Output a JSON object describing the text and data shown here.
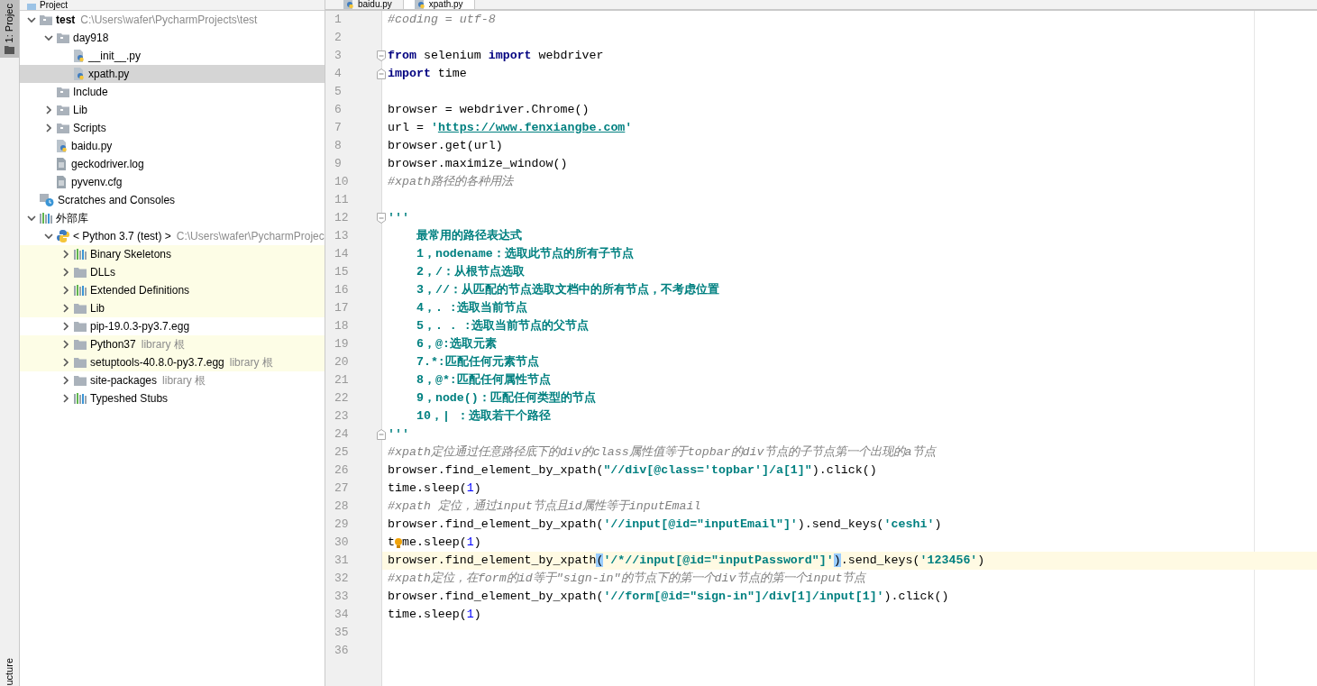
{
  "side_tabs": [
    {
      "label": "1: Projec",
      "selected": true
    },
    {
      "label": "ucture",
      "selected": false
    }
  ],
  "project_panel": {
    "title": "Project",
    "tree": [
      {
        "kind": "module",
        "name": "test",
        "bold": true,
        "hint": "C:\\Users\\wafer\\PycharmProjects\\test",
        "expanded": true,
        "children": [
          {
            "kind": "module",
            "name": "day918",
            "expanded": true,
            "children": [
              {
                "kind": "python",
                "name": "__init__.py"
              },
              {
                "kind": "python",
                "name": "xpath.py",
                "selected": true
              }
            ]
          },
          {
            "kind": "module",
            "name": "Include"
          },
          {
            "kind": "module",
            "name": "Lib",
            "expanded": false
          },
          {
            "kind": "module",
            "name": "Scripts",
            "expanded": false
          },
          {
            "kind": "python",
            "name": "baidu.py"
          },
          {
            "kind": "text",
            "name": "geckodriver.log"
          },
          {
            "kind": "text",
            "name": "pyvenv.cfg"
          }
        ]
      },
      {
        "kind": "scratch",
        "name": "Scratches and Consoles"
      },
      {
        "kind": "library",
        "name": "外部库",
        "expanded": true,
        "children": [
          {
            "kind": "sdk",
            "name": "< Python 3.7 (test) >",
            "hint": "C:\\Users\\wafer\\PycharmProjec",
            "expanded": true,
            "children": [
              {
                "kind": "library",
                "name": "Binary Skeletons",
                "expanded": false,
                "highlighted": true
              },
              {
                "kind": "folder",
                "name": "DLLs",
                "expanded": false,
                "highlighted": true
              },
              {
                "kind": "library",
                "name": "Extended Definitions",
                "expanded": false,
                "highlighted": true
              },
              {
                "kind": "folder",
                "name": "Lib",
                "expanded": false,
                "highlighted": true
              },
              {
                "kind": "folder",
                "name": "pip-19.0.3-py3.7.egg",
                "expanded": false,
                "highlighted": false
              },
              {
                "kind": "folder",
                "name": "Python37",
                "hint": "library 根",
                "expanded": false,
                "highlighted": true
              },
              {
                "kind": "folder",
                "name": "setuptools-40.8.0-py3.7.egg",
                "hint": "library 根",
                "expanded": false,
                "highlighted": true
              },
              {
                "kind": "folder",
                "name": "site-packages",
                "hint": "library 根",
                "expanded": false,
                "highlighted": false
              },
              {
                "kind": "library",
                "name": "Typeshed Stubs",
                "expanded": false,
                "highlighted": false
              }
            ]
          }
        ]
      }
    ]
  },
  "editor": {
    "tabs": [
      {
        "label": "baidu.py",
        "selected": false
      },
      {
        "label": "xpath.py",
        "selected": true
      }
    ],
    "lines": [
      {
        "number": "1",
        "tokens": [
          {
            "kind": "comment",
            "text": "#coding = utf-8"
          }
        ]
      },
      {
        "number": "2"
      },
      {
        "number": "3",
        "fold_start": true,
        "tokens": [
          {
            "kind": "keyword",
            "text": "from"
          },
          {
            "kind": "plain",
            "text": " selenium "
          },
          {
            "kind": "keyword",
            "text": "import"
          },
          {
            "kind": "plain",
            "text": " webdriver"
          }
        ]
      },
      {
        "number": "4",
        "fold_end": true,
        "tokens": [
          {
            "kind": "keyword",
            "text": "import"
          },
          {
            "kind": "plain",
            "text": " time"
          }
        ]
      },
      {
        "number": "5"
      },
      {
        "number": "6",
        "tokens": [
          {
            "kind": "plain",
            "text": "browser = webdriver.Chrome()"
          }
        ]
      },
      {
        "number": "7",
        "tokens": [
          {
            "kind": "plain",
            "text": "url = "
          },
          {
            "kind": "string",
            "text": "'"
          },
          {
            "kind": "url",
            "text": "https://www.fenxiangbe.com"
          },
          {
            "kind": "string",
            "text": "'"
          }
        ]
      },
      {
        "number": "8",
        "tokens": [
          {
            "kind": "plain",
            "text": "browser.get(url)"
          }
        ]
      },
      {
        "number": "9",
        "tokens": [
          {
            "kind": "plain",
            "text": "browser.maximize_window()"
          }
        ]
      },
      {
        "number": "10",
        "tokens": [
          {
            "kind": "comment",
            "text": "#xpath路径的各种用法"
          }
        ]
      },
      {
        "number": "11"
      },
      {
        "number": "12",
        "fold_start": true,
        "tokens": [
          {
            "kind": "string",
            "text": "'''"
          }
        ]
      },
      {
        "number": "13",
        "tokens": [
          {
            "kind": "string",
            "text": "    最常用的路径表达式"
          }
        ]
      },
      {
        "number": "14",
        "tokens": [
          {
            "kind": "string",
            "text": "    1，nodename：选取此节点的所有子节点"
          }
        ]
      },
      {
        "number": "15",
        "tokens": [
          {
            "kind": "string",
            "text": "    2，/：从根节点选取"
          }
        ]
      },
      {
        "number": "16",
        "tokens": [
          {
            "kind": "string",
            "text": "    3，//：从匹配的节点选取文档中的所有节点，不考虑位置"
          }
        ]
      },
      {
        "number": "17",
        "tokens": [
          {
            "kind": "string",
            "text": "    4，. :选取当前节点"
          }
        ]
      },
      {
        "number": "18",
        "tokens": [
          {
            "kind": "string",
            "text": "    5，. . :选取当前节点的父节点"
          }
        ]
      },
      {
        "number": "19",
        "tokens": [
          {
            "kind": "string",
            "text": "    6，@:选取元素"
          }
        ]
      },
      {
        "number": "20",
        "tokens": [
          {
            "kind": "string",
            "text": "    7.*:匹配任何元素节点"
          }
        ]
      },
      {
        "number": "21",
        "tokens": [
          {
            "kind": "string",
            "text": "    8，@*:匹配任何属性节点"
          }
        ]
      },
      {
        "number": "22",
        "tokens": [
          {
            "kind": "string",
            "text": "    9，node()：匹配任何类型的节点"
          }
        ]
      },
      {
        "number": "23",
        "tokens": [
          {
            "kind": "string",
            "text": "    10，| ：选取若干个路径"
          }
        ]
      },
      {
        "number": "24",
        "fold_end": true,
        "tokens": [
          {
            "kind": "string",
            "text": "'''"
          }
        ]
      },
      {
        "number": "25",
        "tokens": [
          {
            "kind": "comment",
            "text": "#xpath定位通过任意路径底下的div的class属性值等于topbar的div节点的子节点第一个出现的a节点"
          }
        ]
      },
      {
        "number": "26",
        "tokens": [
          {
            "kind": "plain",
            "text": "browser.find_element_by_xpath("
          },
          {
            "kind": "string",
            "text": "\"//div[@class='topbar']/a[1]\""
          },
          {
            "kind": "plain",
            "text": ").click()"
          }
        ]
      },
      {
        "number": "27",
        "tokens": [
          {
            "kind": "plain",
            "text": "time.sleep("
          },
          {
            "kind": "number",
            "text": "1"
          },
          {
            "kind": "plain",
            "text": ")"
          }
        ]
      },
      {
        "number": "28",
        "tokens": [
          {
            "kind": "comment",
            "text": "#xpath 定位，通过input节点且id属性等于inputEmail"
          }
        ]
      },
      {
        "number": "29",
        "tokens": [
          {
            "kind": "plain",
            "text": "browser.find_element_by_xpath("
          },
          {
            "kind": "string",
            "text": "'//input[@id=\"inputEmail\"]'"
          },
          {
            "kind": "plain",
            "text": ").send_keys("
          },
          {
            "kind": "string",
            "text": "'ceshi'"
          },
          {
            "kind": "plain",
            "text": ")"
          }
        ]
      },
      {
        "number": "30",
        "tokens": [
          {
            "kind": "plain",
            "text": "t"
          },
          {
            "kind": "bulb"
          },
          {
            "kind": "plain",
            "text": "me.sleep("
          },
          {
            "kind": "number",
            "text": "1"
          },
          {
            "kind": "plain",
            "text": ")"
          }
        ]
      },
      {
        "number": "31",
        "current": true,
        "tokens": [
          {
            "kind": "plain",
            "text": "browser.find_element_by_xpath"
          },
          {
            "kind": "plain",
            "text": "(",
            "matched": true
          },
          {
            "kind": "string",
            "text": "'/*//input[@id=\"inputPassword\"]'"
          },
          {
            "kind": "plain",
            "text": ")",
            "matched": true
          },
          {
            "kind": "plain",
            "text": ".send_keys("
          },
          {
            "kind": "string",
            "text": "'123456'"
          },
          {
            "kind": "plain",
            "text": ")"
          }
        ]
      },
      {
        "number": "32",
        "tokens": [
          {
            "kind": "comment",
            "text": "#xpath定位，在form的id等于\"sign-in\"的节点下的第一个div节点的第一个input节点"
          }
        ]
      },
      {
        "number": "33",
        "tokens": [
          {
            "kind": "plain",
            "text": "browser.find_element_by_xpath("
          },
          {
            "kind": "string",
            "text": "'//form[@id=\"sign-in\"]/div[1]/input[1]'"
          },
          {
            "kind": "plain",
            "text": ").click()"
          }
        ]
      },
      {
        "number": "34",
        "tokens": [
          {
            "kind": "plain",
            "text": "time.sleep("
          },
          {
            "kind": "number",
            "text": "1"
          },
          {
            "kind": "plain",
            "text": ")"
          }
        ]
      },
      {
        "number": "35"
      },
      {
        "number": "36"
      }
    ]
  }
}
